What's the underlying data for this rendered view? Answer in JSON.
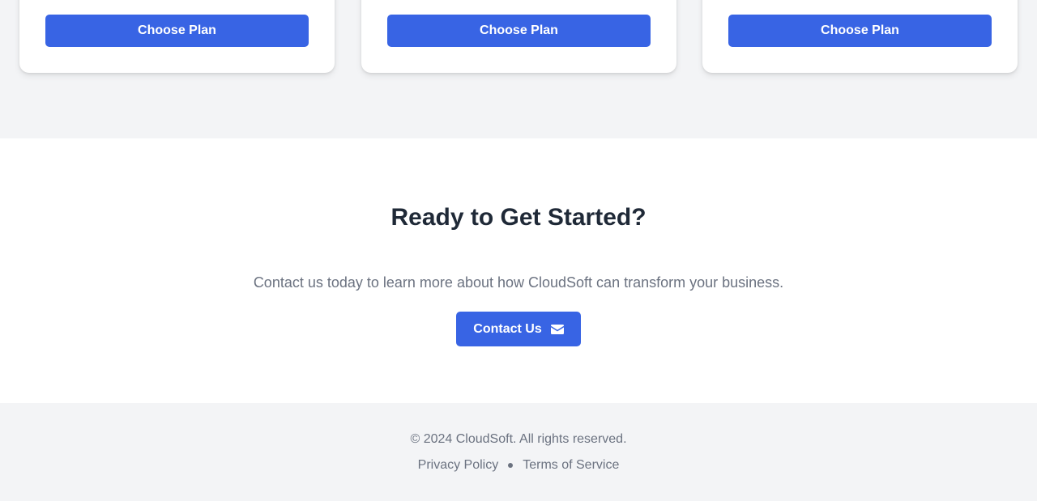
{
  "pricing": {
    "plans": [
      {
        "button_label": "Choose Plan"
      },
      {
        "button_label": "Choose Plan"
      },
      {
        "button_label": "Choose Plan"
      }
    ]
  },
  "cta": {
    "title": "Ready to Get Started?",
    "text": "Contact us today to learn more about how CloudSoft can transform your business.",
    "button_label": "Contact Us",
    "button_icon": "envelope-icon"
  },
  "footer": {
    "copyright": "© 2024 CloudSoft. All rights reserved.",
    "links": [
      {
        "label": "Privacy Policy"
      },
      {
        "label": "Terms of Service"
      }
    ]
  },
  "colors": {
    "accent": "#3864e4",
    "section_gray": "#f3f4f6",
    "heading": "#1f2937",
    "muted_text": "#6b7280"
  }
}
